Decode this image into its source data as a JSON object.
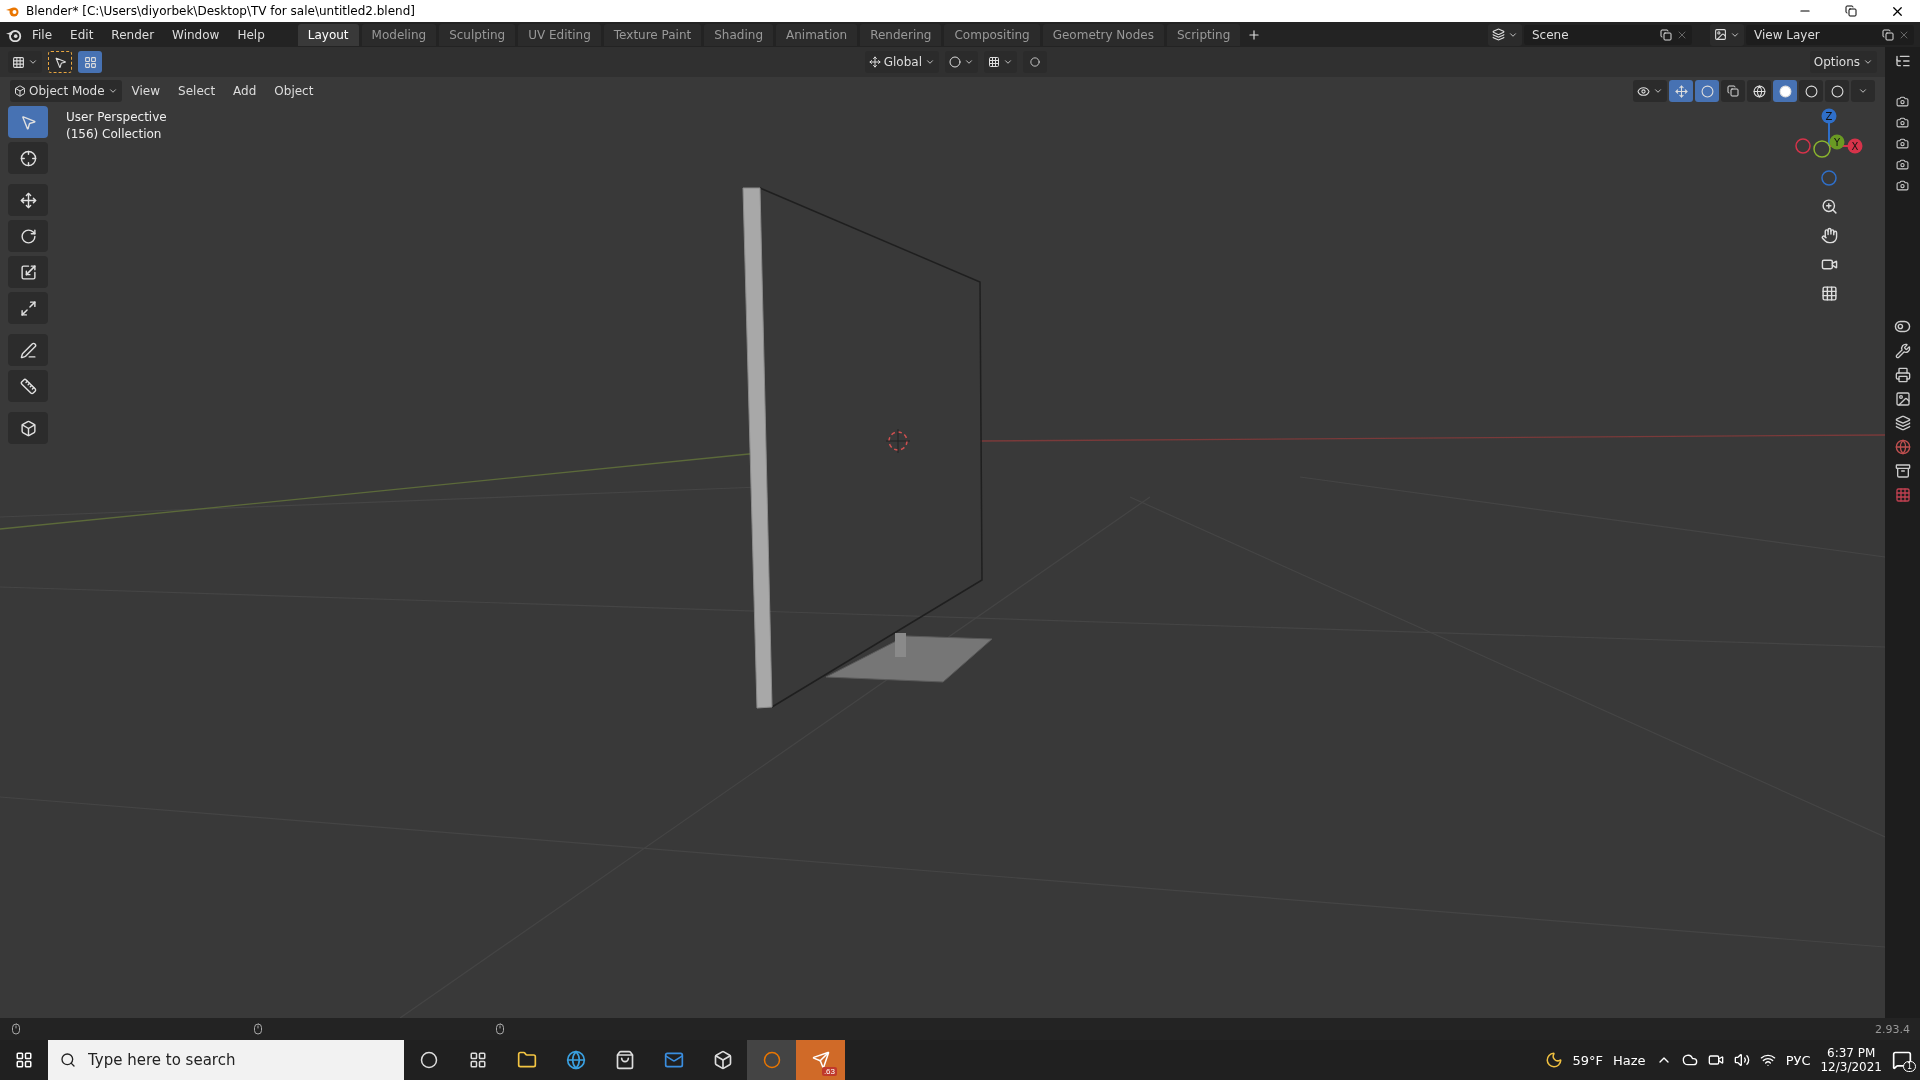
{
  "window": {
    "title": "Blender* [C:\\Users\\diyorbek\\Desktop\\TV for sale\\untitled2.blend]"
  },
  "menu": [
    "File",
    "Edit",
    "Render",
    "Window",
    "Help"
  ],
  "workspaces": [
    {
      "label": "Layout",
      "selected": true
    },
    {
      "label": "Modeling",
      "selected": false
    },
    {
      "label": "Sculpting",
      "selected": false
    },
    {
      "label": "UV Editing",
      "selected": false
    },
    {
      "label": "Texture Paint",
      "selected": false
    },
    {
      "label": "Shading",
      "selected": false
    },
    {
      "label": "Animation",
      "selected": false
    },
    {
      "label": "Rendering",
      "selected": false
    },
    {
      "label": "Compositing",
      "selected": false
    },
    {
      "label": "Geometry Nodes",
      "selected": false
    },
    {
      "label": "Scripting",
      "selected": false
    }
  ],
  "scene": {
    "value": "Scene"
  },
  "view_layer": {
    "value": "View Layer"
  },
  "tool_header": {
    "orientation": "Global",
    "options": "Options"
  },
  "viewport": {
    "mode": "Object Mode",
    "menus": [
      "View",
      "Select",
      "Add",
      "Object"
    ],
    "overlay_lines": [
      "User Perspective",
      "(156) Collection"
    ],
    "tools": [
      {
        "kind": "select",
        "selected": true
      },
      {
        "kind": "cursor",
        "selected": false
      },
      {
        "kind": "move",
        "selected": false
      },
      {
        "kind": "rotate",
        "selected": false
      },
      {
        "kind": "scale",
        "selected": false
      },
      {
        "kind": "transform",
        "selected": false
      },
      {
        "kind": "annotate",
        "selected": false
      },
      {
        "kind": "measure",
        "selected": false
      },
      {
        "kind": "add",
        "selected": false
      }
    ],
    "shading": [
      {
        "kind": "wireframe",
        "selected": false
      },
      {
        "kind": "solid",
        "selected": true
      },
      {
        "kind": "material",
        "selected": false
      },
      {
        "kind": "rendered",
        "selected": false
      }
    ],
    "gizmo_axes": [
      "Z",
      "Y",
      "X"
    ]
  },
  "status_bar": {
    "version": "2.93.4"
  },
  "taskbar": {
    "search": {
      "placeholder": "Type here to search"
    },
    "telegram_badge": ".63",
    "temperature": "59°F",
    "condition": "Haze",
    "language": "РУС",
    "time": "6:37 PM",
    "date": "12/3/2021",
    "notifications": "1"
  }
}
